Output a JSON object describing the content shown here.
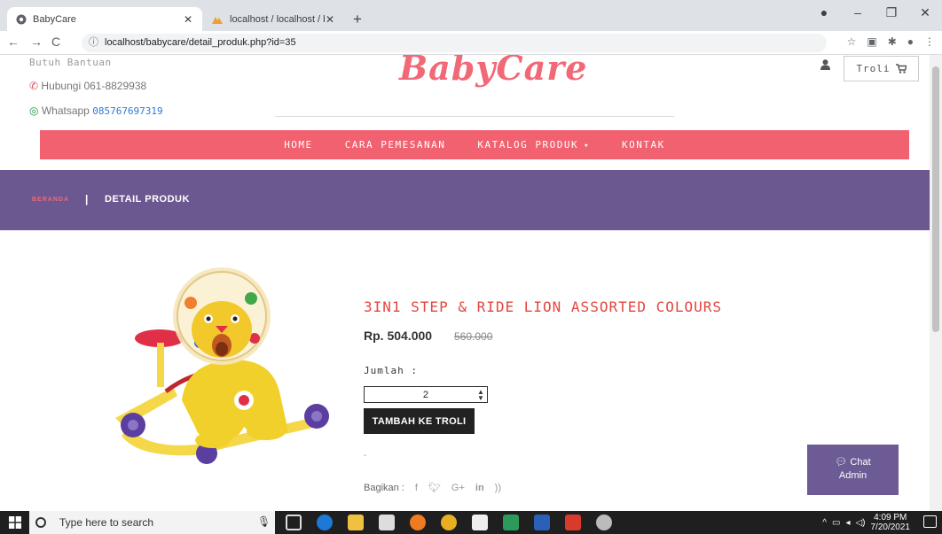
{
  "browser": {
    "tabs": [
      {
        "title": "BabyCare",
        "active": true
      },
      {
        "title": "localhost / localhost / babycare /",
        "active": false
      }
    ],
    "url": "localhost/babycare/detail_produk.php?id=35"
  },
  "header": {
    "help_title": "Butuh Bantuan",
    "phone_label": "Hubungi 061-8829938",
    "whatsapp_label": "Whatsapp",
    "whatsapp_number": "085767697319",
    "logo_text": "BabyCare",
    "cart_label": "Troli"
  },
  "nav": {
    "items": [
      "HOME",
      "CARA PEMESANAN",
      "KATALOG PRODUK",
      "KONTAK"
    ],
    "catalog_caret": "▾"
  },
  "breadcrumb": {
    "home": "BERANDA",
    "separator": "|",
    "current": "DETAIL PRODUK"
  },
  "product": {
    "name": "3IN1 STEP & RIDE LION ASSORTED COLOURS",
    "price": "Rp. 504.000",
    "old_price": "560.000",
    "qty_label": "Jumlah :",
    "qty_value": "2",
    "add_button": "TAMBAH KE TROLI",
    "dash": "-",
    "share_label": "Bagikan :",
    "share_icons": [
      "f",
      "t",
      "G+",
      "in",
      "rss"
    ]
  },
  "chat": {
    "label_line1": "Chat",
    "label_line2": "Admin"
  },
  "taskbar": {
    "search_placeholder": "Type here to search",
    "time": "4:09 PM",
    "date": "7/20/2021"
  },
  "colors": {
    "primary_pink": "#f16170",
    "purple": "#6b5890",
    "product_name": "#e2463f"
  }
}
